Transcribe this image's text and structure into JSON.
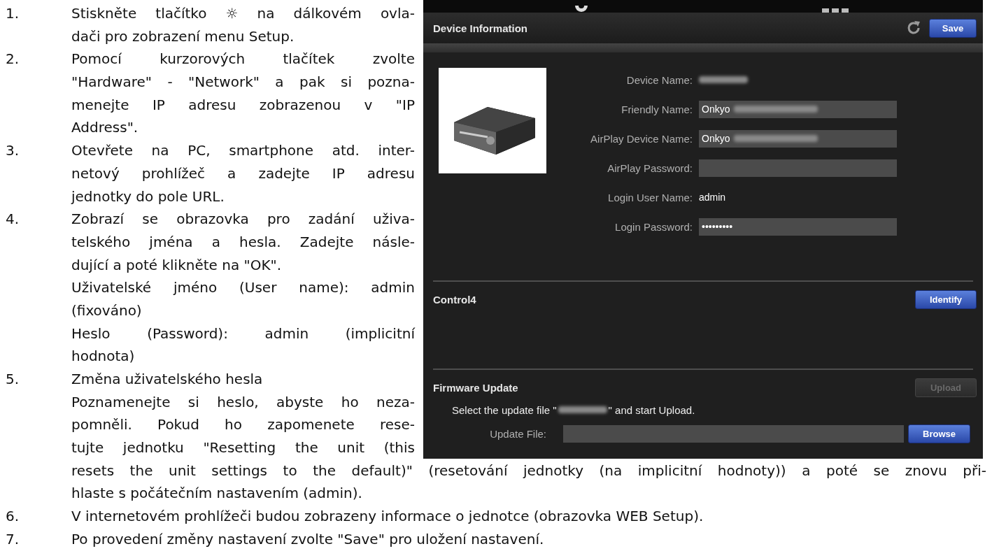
{
  "steps": [
    {
      "number": "1.",
      "paragraphs": [
        [
          "Stiskněte tlačítko ☼ na dálkovém ovla-",
          "dači pro zobrazení menu Setup."
        ]
      ]
    },
    {
      "number": "2.",
      "paragraphs": [
        [
          "Pomocí kurzorových tlačítek zvolte",
          "\"Hardware\" - \"Network\" a pak si pozna-",
          "menejte IP adresu zobrazenou v \"IP",
          "Address\"."
        ]
      ]
    },
    {
      "number": "3.",
      "paragraphs": [
        [
          "Otevřete na PC, smartphone atd. inter-",
          "netový prohlížeč a zadejte IP adresu",
          "jednotky do pole URL."
        ]
      ]
    },
    {
      "number": "4.",
      "paragraphs": [
        [
          "Zobrazí se obrazovka pro zadání uživa-",
          "telského jména a hesla. Zadejte násle-",
          "dující a poté klikněte na \"OK\"."
        ],
        [
          "Uživatelské jméno (User name): admin",
          "(fixováno)"
        ],
        [
          "Heslo (Password): admin (implicitní",
          "hodnota)"
        ]
      ]
    },
    {
      "number": "5.",
      "paragraphs": [
        [
          "Změna uživatelského hesla"
        ],
        [
          "Poznamenejte si heslo, abyste ho neza-",
          "pomněli. Pokud ho zapomenete rese-",
          "tujte jednotku \"Resetting the unit (this",
          "resets the unit settings to the default)\" (resetování jednotky (na implicitní hodnoty)) a poté se znovu při-",
          "hlaste s počátečním nastavením (admin)."
        ]
      ]
    },
    {
      "number": "6.",
      "paragraphs": [
        [
          "V internetovém prohlížeči budou zobrazeny informace o jednotce (obrazovka WEB Setup)."
        ]
      ]
    },
    {
      "number": "7.",
      "paragraphs": [
        [
          "Po provedení změny nastavení zvolte \"Save\" pro uložení nastavení."
        ]
      ]
    }
  ],
  "web_setup": {
    "device_information": {
      "title": "Device Information",
      "save_button": {
        "label": "Save",
        "disabled": false
      },
      "fields": [
        {
          "label": "Device Name:",
          "kind": "readonly",
          "blurred": true
        },
        {
          "label": "Friendly Name:",
          "kind": "input",
          "value": "Onkyo",
          "blurred": true
        },
        {
          "label": "AirPlay Device Name:",
          "kind": "input",
          "value": "Onkyo",
          "blurred": true
        },
        {
          "label": "AirPlay Password:",
          "kind": "input"
        },
        {
          "label": "Login User Name:",
          "kind": "readonly",
          "value": "admin"
        },
        {
          "label": "Login Password:",
          "kind": "input",
          "value": "•••••••••"
        }
      ]
    },
    "control4": {
      "title": "Control4",
      "button": {
        "label": "Identify",
        "disabled": false
      }
    },
    "firmware_update": {
      "title": "Firmware Update",
      "button": {
        "label": "Upload",
        "disabled": true
      },
      "instruction_before": "Select the update file \"",
      "file_name_blurred": true,
      "instruction_after": "\" and start Upload.",
      "file_label": "Update File:",
      "browse_button": {
        "label": "Browse",
        "disabled": false
      }
    }
  }
}
